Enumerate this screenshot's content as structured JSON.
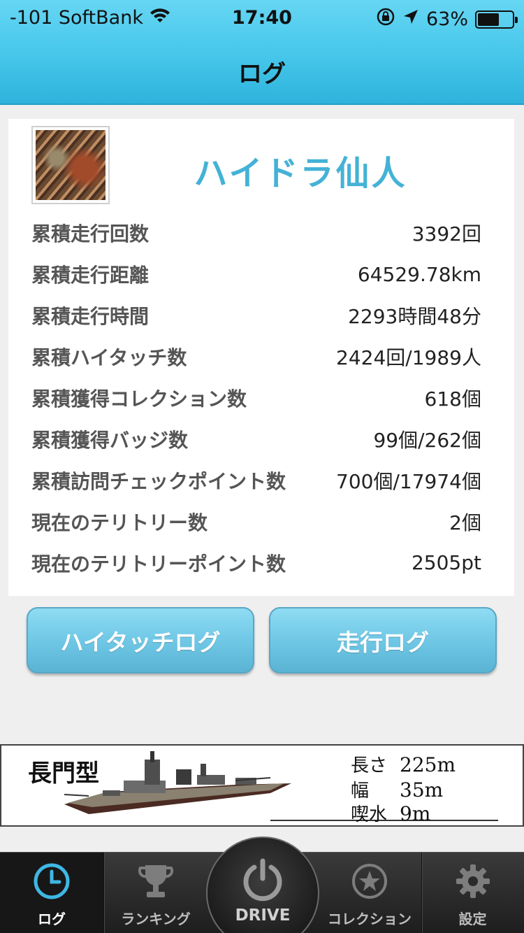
{
  "status_bar": {
    "carrier": "-101 SoftBank",
    "time": "17:40",
    "battery": "63%",
    "battery_level": 0.63
  },
  "nav": {
    "title": "ログ"
  },
  "profile": {
    "username": "ハイドラ仙人"
  },
  "stats": [
    {
      "label": "累積走行回数",
      "value": "3392回"
    },
    {
      "label": "累積走行距離",
      "value": "64529.78km"
    },
    {
      "label": "累積走行時間",
      "value": "2293時間48分"
    },
    {
      "label": "累積ハイタッチ数",
      "value": "2424回/1989人"
    },
    {
      "label": "累積獲得コレクション数",
      "value": "618個"
    },
    {
      "label": "累積獲得バッジ数",
      "value": "99個/262個"
    },
    {
      "label": "累積訪問チェックポイント数",
      "value": "700個/17974個"
    },
    {
      "label": "現在のテリトリー数",
      "value": "2個"
    },
    {
      "label": "現在のテリトリーポイント数",
      "value": "2505pt"
    }
  ],
  "buttons": {
    "hightouch_log": "ハイタッチログ",
    "drive_log": "走行ログ"
  },
  "banner": {
    "name": "長門型",
    "specs": [
      {
        "key": "長さ",
        "value": "225m"
      },
      {
        "key": "幅",
        "value": "35m"
      },
      {
        "key": "喫水",
        "value": "9m"
      }
    ]
  },
  "tabs": {
    "log": "ログ",
    "ranking": "ランキング",
    "drive": "DRIVE",
    "collection": "コレクション",
    "settings": "設定"
  },
  "colors": {
    "accent": "#44b2d6",
    "nav_bar": "#45c6ea",
    "button": "#6fc8e6",
    "tab_active_icon": "#3fb7e3"
  }
}
